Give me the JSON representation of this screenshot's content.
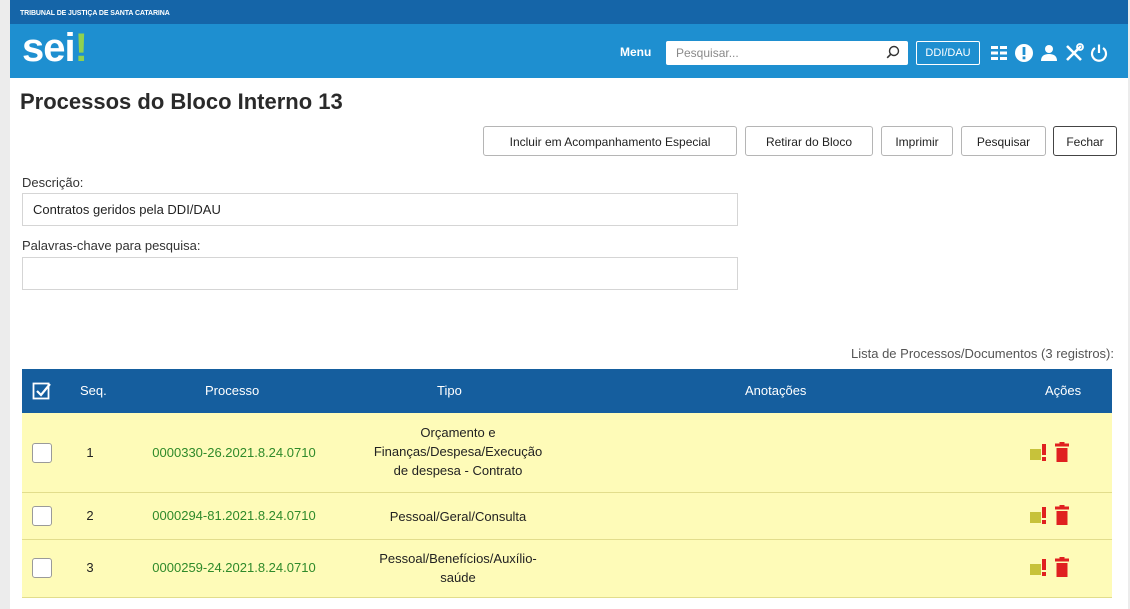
{
  "header": {
    "org": "TRIBUNAL DE JUSTIÇA DE SANTA CATARINA",
    "logo_main": "sei",
    "logo_dot": "!",
    "menu_label": "Menu",
    "search_placeholder": "Pesquisar...",
    "unit": "DDI/DAU",
    "icons": [
      "grid-icon",
      "alert-icon",
      "user-icon",
      "tools-icon",
      "power-icon"
    ]
  },
  "page": {
    "title": "Processos do Bloco Interno 13"
  },
  "toolbar": {
    "incluir": "Incluir em Acompanhamento Especial",
    "retirar": "Retirar do Bloco",
    "imprimir": "Imprimir",
    "pesquisar": "Pesquisar",
    "fechar": "Fechar"
  },
  "form": {
    "descricao_label": "Descrição:",
    "descricao_value": "Contratos geridos pela DDI/DAU",
    "palavras_label": "Palavras-chave para pesquisa:",
    "palavras_value": ""
  },
  "table": {
    "caption": "Lista de Processos/Documentos (3 registros):",
    "headers": {
      "seq": "Seq.",
      "processo": "Processo",
      "tipo": "Tipo",
      "anotacoes": "Anotações",
      "acoes": "Ações"
    },
    "rows": [
      {
        "seq": "1",
        "processo": "0000330-26.2021.8.24.0710",
        "tipo": [
          "Orçamento e",
          "Finanças/Despesa/Execução",
          "de despesa - Contrato"
        ]
      },
      {
        "seq": "2",
        "processo": "0000294-81.2021.8.24.0710",
        "tipo": [
          "Pessoal/Geral/Consulta"
        ]
      },
      {
        "seq": "3",
        "processo": "0000259-24.2021.8.24.0710",
        "tipo": [
          "Pessoal/Benefícios/Auxílio-",
          "saúde"
        ]
      }
    ]
  },
  "colors": {
    "header_blue": "#1e8fd0",
    "table_header": "#155e9e",
    "row_highlight": "#fefbb8",
    "process_link": "#2f8a2a",
    "delete_red": "#e02020"
  }
}
